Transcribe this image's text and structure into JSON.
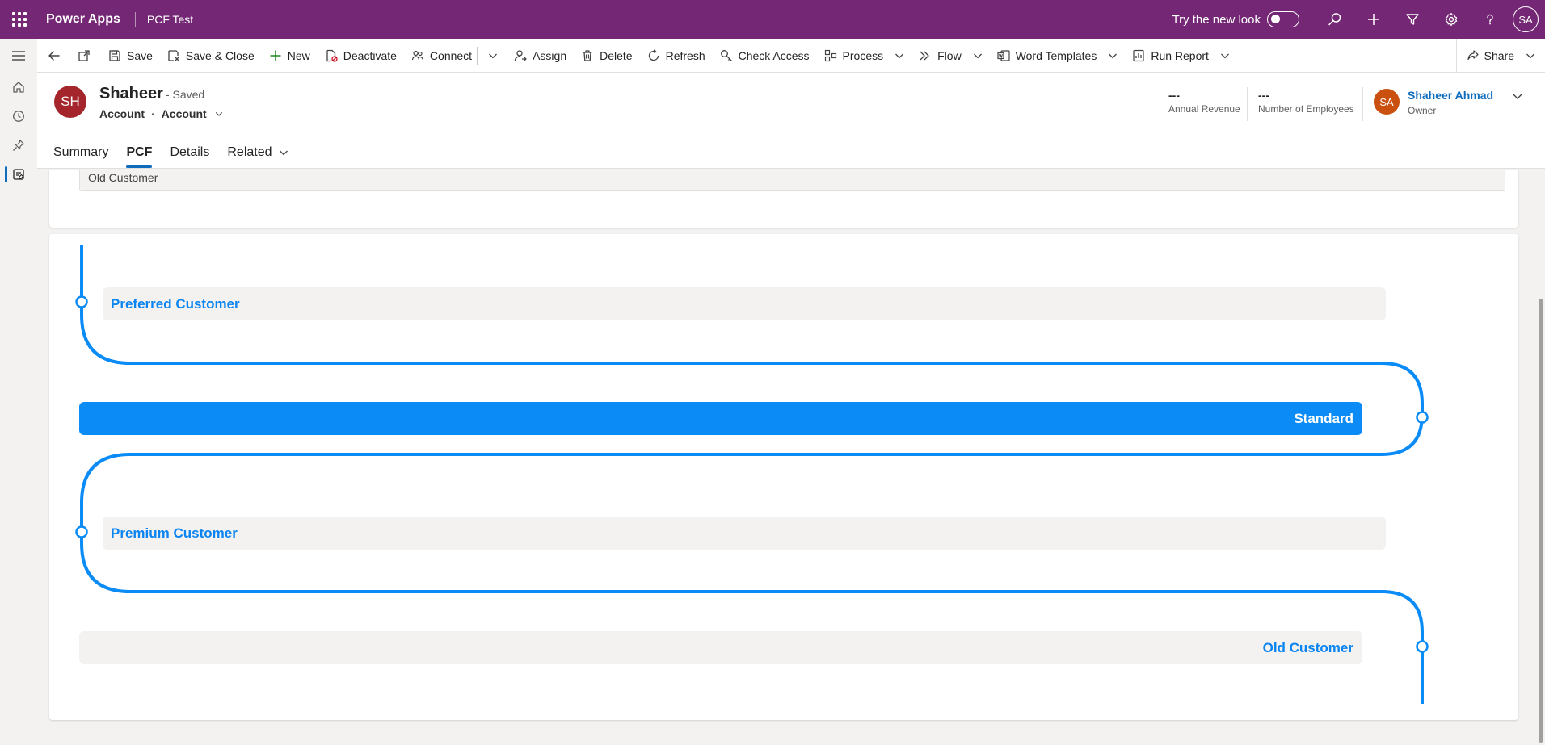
{
  "topbar": {
    "app_name": "Power Apps",
    "env_name": "PCF Test",
    "try_new_look": "Try the new look",
    "user_initials": "SA"
  },
  "commands": {
    "save": "Save",
    "save_close": "Save & Close",
    "new": "New",
    "deactivate": "Deactivate",
    "connect": "Connect",
    "assign": "Assign",
    "delete": "Delete",
    "refresh": "Refresh",
    "check_access": "Check Access",
    "process": "Process",
    "flow": "Flow",
    "word_templates": "Word Templates",
    "run_report": "Run Report",
    "share": "Share"
  },
  "record": {
    "initials": "SH",
    "name": "Shaheer",
    "saved_status": "- Saved",
    "entity": "Account",
    "form": "Account",
    "annual_revenue_value": "---",
    "annual_revenue_label": "Annual Revenue",
    "employees_value": "---",
    "employees_label": "Number of Employees",
    "owner_initials": "SA",
    "owner_name": "Shaheer Ahmad",
    "owner_label": "Owner"
  },
  "tabs": [
    "Summary",
    "PCF",
    "Details",
    "Related"
  ],
  "active_tab": "PCF",
  "field_value": "Old Customer",
  "stages": [
    {
      "label": "Preferred Customer",
      "active": false
    },
    {
      "label": "Standard",
      "active": true
    },
    {
      "label": "Premium Customer",
      "active": false
    },
    {
      "label": "Old Customer",
      "active": false
    }
  ],
  "colors": {
    "topbar": "#742774",
    "accent": "#0a8bf5",
    "link": "#0f6cbd"
  }
}
